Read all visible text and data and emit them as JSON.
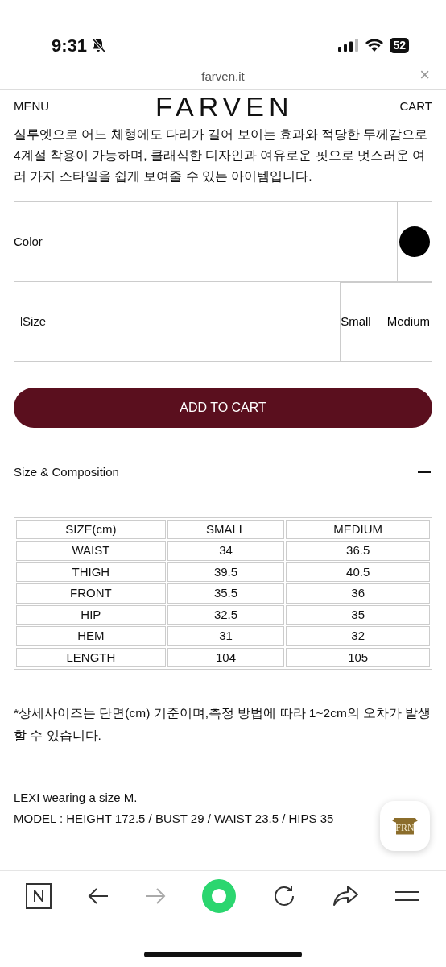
{
  "status_bar": {
    "time": "9:31",
    "battery": "52"
  },
  "browser": {
    "url": "farven.it",
    "close": "×"
  },
  "header": {
    "menu": "MENU",
    "logo": "FARVEN",
    "cart": "CART"
  },
  "description": "실루엣으로 어느 체형에도 다리가 길어 보이는 효과와 적당한 두께감으로 4계절 착용이 가능하며, 클래식한 디자인과 여유로운 핏으로 멋스러운 여러 가지 스타일을 쉽게 보여줄 수 있는 아이템입니다.",
  "options": [
    {
      "kind": "color",
      "label": "Color",
      "choices": [
        {
          "color": "#000000"
        }
      ]
    },
    {
      "kind": "size",
      "label": "Size",
      "choices": [
        {
          "label": "Small"
        },
        {
          "label": "Medium"
        }
      ]
    }
  ],
  "add_to_cart": "ADD TO CART",
  "section": {
    "title": "Size & Composition",
    "expanded": true
  },
  "size_table": {
    "columns": [
      "SIZE(cm)",
      "SMALL",
      "MEDIUM"
    ],
    "rows": [
      [
        "WAIST",
        "34",
        "36.5"
      ],
      [
        "THIGH",
        "39.5",
        "40.5"
      ],
      [
        "FRONT",
        "35.5",
        "36"
      ],
      [
        "HIP",
        "32.5",
        "35"
      ],
      [
        "HEM",
        "31",
        "32"
      ],
      [
        "LENGTH",
        "104",
        "105"
      ]
    ]
  },
  "note": "*상세사이즈는 단면(cm) 기준이며,측정 방법에 따라 1~2cm의 오차가 발생할 수 있습니다.",
  "model_lines": [
    "LEXI wearing a size M.",
    "MODEL : HEIGHT 172.5 / BUST 29 / WAIST 23.5 / HIPS 35"
  ],
  "chat_badge": "FRN"
}
